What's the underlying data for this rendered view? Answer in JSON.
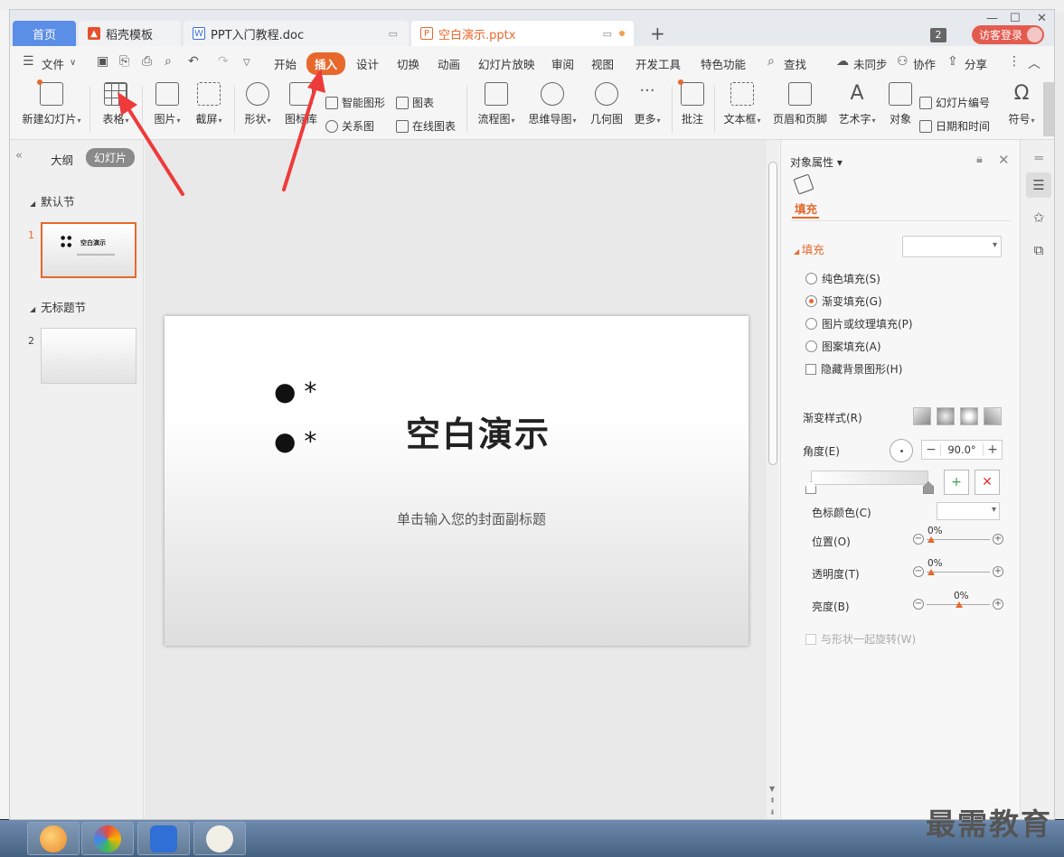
{
  "tabs": {
    "home": "首页",
    "template": "稻壳模板",
    "doc": "PPT入门教程.doc",
    "ppt": "空白演示.pptx",
    "new_tab": "+"
  },
  "titlebar": {
    "badge_count": "2",
    "login_label": "访客登录"
  },
  "menu": {
    "file": "文件",
    "start": "开始",
    "insert": "插入",
    "design": "设计",
    "transition": "切换",
    "animation": "动画",
    "slideshow": "幻灯片放映",
    "review": "审阅",
    "view": "视图",
    "devtools": "开发工具",
    "special": "特色功能",
    "search": "查找",
    "unsync": "未同步",
    "collab": "协作",
    "share": "分享"
  },
  "ribbon": {
    "new_slide": "新建幻灯片",
    "table": "表格",
    "picture": "图片",
    "screenshot": "截屏",
    "shape": "形状",
    "icon_lib": "图标库",
    "smart_art": "智能图形",
    "relation": "关系图",
    "chart": "图表",
    "online_chart": "在线图表",
    "flowchart": "流程图",
    "mindmap": "思维导图",
    "geometry": "几何图",
    "more": "更多",
    "comment": "批注",
    "textbox": "文本框",
    "header_footer": "页眉和页脚",
    "wordart": "艺术字",
    "object": "对象",
    "slide_number": "幻灯片编号",
    "date_time": "日期和时间",
    "symbol": "符号"
  },
  "left_panel": {
    "outline": "大纲",
    "slides": "幻灯片",
    "section_default": "默认节",
    "section_untitled": "无标题节",
    "slide1_num": "1",
    "slide2_num": "2",
    "thumb_title": "空白演示"
  },
  "slide": {
    "bullet1": "● *",
    "bullet2": "● *",
    "title": "空白演示",
    "subtitle": "单击输入您的封面副标题"
  },
  "properties": {
    "header": "对象属性",
    "tab_fill": "填充",
    "section_fill": "填充",
    "solid": "纯色填充(S)",
    "gradient": "渐变填充(G)",
    "picture_texture": "图片或纹理填充(P)",
    "pattern": "图案填充(A)",
    "hide_bg": "隐藏背景图形(H)",
    "gradient_style": "渐变样式(R)",
    "angle": "角度(E)",
    "angle_value": "90.0°",
    "stop_color": "色标颜色(C)",
    "position": "位置(O)",
    "position_value": "0%",
    "transparency": "透明度(T)",
    "transparency_value": "0%",
    "brightness": "亮度(B)",
    "brightness_value": "0%",
    "rotate_with_shape": "与形状一起旋转(W)"
  },
  "watermark": "最需教育",
  "colors": {
    "accent": "#e8682c",
    "home_tab": "#5b8ee6",
    "login": "#e35b4f",
    "arrow": "#ee3a3a"
  }
}
